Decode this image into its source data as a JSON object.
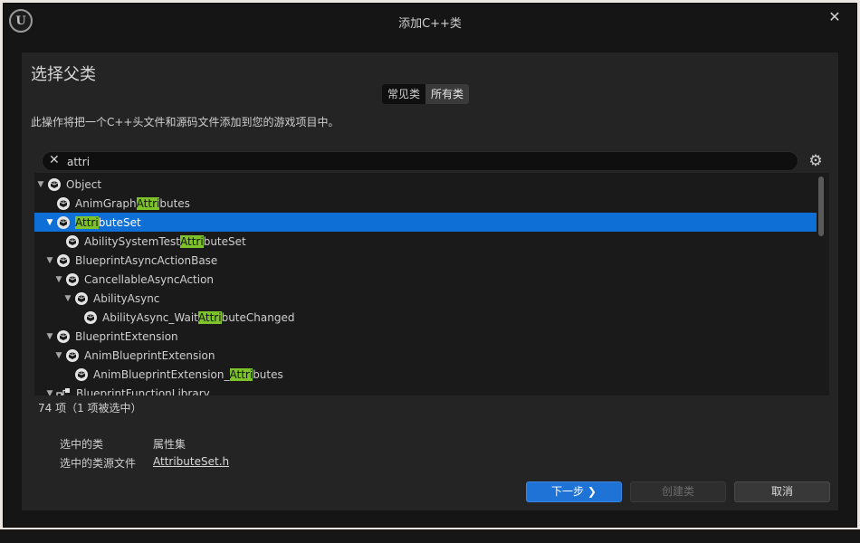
{
  "window": {
    "title": "添加C++类",
    "logo": "U"
  },
  "panel": {
    "heading": "选择父类",
    "tabs": [
      "常见类",
      "所有类"
    ],
    "active_tab": "所有类",
    "description": "此操作将把一个C++头文件和源码文件添加到您的游戏项目中。"
  },
  "search": {
    "value": "attri",
    "placeholder": ""
  },
  "tree": {
    "rows": [
      {
        "depth": 0,
        "expanded": true,
        "pre": "Object",
        "match": "",
        "post": "",
        "icon": "class-icon"
      },
      {
        "depth": 1,
        "expanded": null,
        "pre": "AnimGraph",
        "match": "Attri",
        "post": "butes",
        "icon": "class-icon"
      },
      {
        "depth": 1,
        "expanded": true,
        "pre": "",
        "match": "Attri",
        "post": "buteSet",
        "icon": "class-icon",
        "selected": true
      },
      {
        "depth": 2,
        "expanded": null,
        "pre": "AbilitySystemTest",
        "match": "Attri",
        "post": "buteSet",
        "icon": "class-icon"
      },
      {
        "depth": 1,
        "expanded": true,
        "pre": "BlueprintAsyncActionBase",
        "match": "",
        "post": "",
        "icon": "class-icon"
      },
      {
        "depth": 2,
        "expanded": true,
        "pre": "CancellableAsyncAction",
        "match": "",
        "post": "",
        "icon": "class-icon"
      },
      {
        "depth": 3,
        "expanded": true,
        "pre": "AbilityAsync",
        "match": "",
        "post": "",
        "icon": "class-icon"
      },
      {
        "depth": 4,
        "expanded": null,
        "pre": "AbilityAsync_Wait",
        "match": "Attri",
        "post": "buteChanged",
        "icon": "class-icon"
      },
      {
        "depth": 1,
        "expanded": true,
        "pre": "BlueprintExtension",
        "match": "",
        "post": "",
        "icon": "class-icon"
      },
      {
        "depth": 2,
        "expanded": true,
        "pre": "AnimBlueprintExtension",
        "match": "",
        "post": "",
        "icon": "class-icon"
      },
      {
        "depth": 3,
        "expanded": null,
        "pre": "AnimBlueprintExtension_",
        "match": "Attri",
        "post": "butes",
        "icon": "class-icon"
      },
      {
        "depth": 1,
        "expanded": true,
        "pre": "BlueprintFunctionLibrary",
        "match": "",
        "post": "",
        "icon": "function-library-icon"
      }
    ]
  },
  "status": {
    "count": "74 项（1 项被选中）"
  },
  "selection": {
    "class_label": "选中的类",
    "class_value": "属性集",
    "file_label": "选中的类源文件",
    "file_value": "AttributeSet.h"
  },
  "buttons": {
    "next": "下一步",
    "create": "创建类",
    "cancel": "取消"
  },
  "colors": {
    "selection": "#0e6fd6",
    "highlight": "#7cc228",
    "primary_button": "#1f72d6"
  }
}
